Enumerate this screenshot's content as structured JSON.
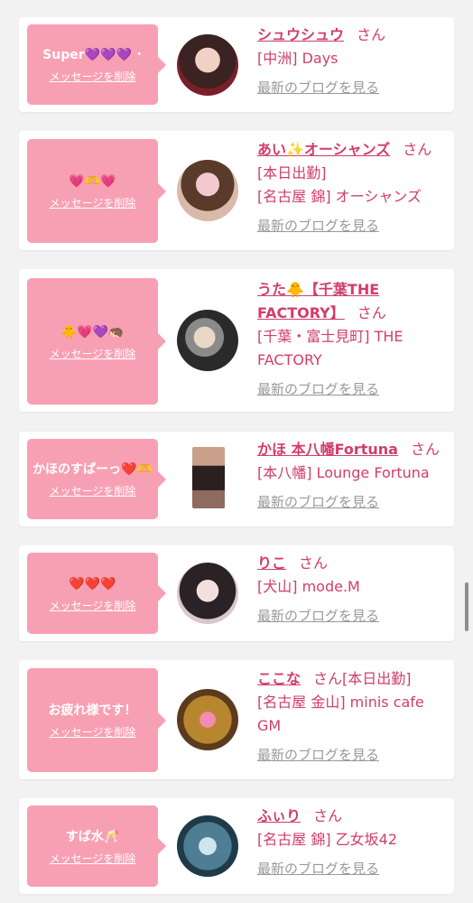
{
  "delete_label": "メッセージを削除",
  "blog_label": "最新のブログを見る",
  "san": "さん",
  "accent_color": "#d23d6a",
  "bubble_color": "#f8a0b3",
  "cards": [
    {
      "message": "Super💜💜💜 ･",
      "name": "シュウシュウ",
      "location": "[中洲] Days"
    },
    {
      "message": "💗🫶💗",
      "name": "あい✨オーシャンズ",
      "location": "[名古屋 錦] オーシャンズ",
      "note": "[本日出勤]"
    },
    {
      "message": "🐥💗💜🦔",
      "name": "うた🐥【千葉THE FACTORY】",
      "location": "[千葉・富士見町] THE FACTORY"
    },
    {
      "message": "かほのすぱーっ❤️🫶",
      "name": "かほ 本八幡Fortuna",
      "location": "[本八幡] Lounge Fortuna"
    },
    {
      "message": "❤️❤️❤️",
      "name": "りこ",
      "location": "[犬山] mode.M"
    },
    {
      "message": "お疲れ様です！",
      "name": "ここな",
      "location": "[名古屋 金山] minis cafe GM",
      "note": "[本日出勤]"
    },
    {
      "message": "すば水🥂",
      "name": "ふぃり",
      "location": "[名古屋 錦] 乙女坂42"
    }
  ]
}
